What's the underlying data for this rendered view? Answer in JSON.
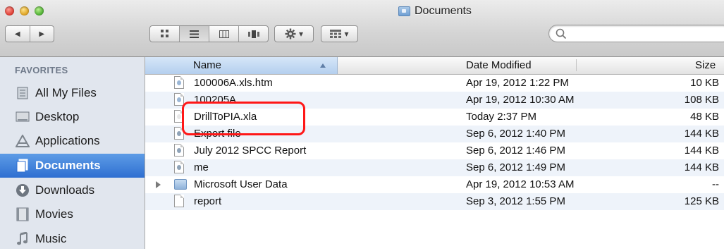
{
  "window": {
    "title": "Documents"
  },
  "toolbar": {
    "back_label": "◀",
    "forward_label": "▶",
    "view_icon": "▾",
    "search_placeholder": ""
  },
  "sidebar": {
    "heading": "FAVORITES",
    "items": [
      {
        "label": "All My Files",
        "icon": "all-files-icon"
      },
      {
        "label": "Desktop",
        "icon": "desktop-icon"
      },
      {
        "label": "Applications",
        "icon": "applications-icon"
      },
      {
        "label": "Documents",
        "icon": "documents-icon",
        "selected": true
      },
      {
        "label": "Downloads",
        "icon": "downloads-icon"
      },
      {
        "label": "Movies",
        "icon": "movies-icon"
      },
      {
        "label": "Music",
        "icon": "music-icon"
      }
    ]
  },
  "list": {
    "columns": {
      "name": "Name",
      "date": "Date Modified",
      "size": "Size"
    },
    "rows": [
      {
        "name": "100006A.xls.htm",
        "date": "Apr 19, 2012 1:22 PM",
        "size": "10 KB"
      },
      {
        "name": "100205A",
        "date": "Apr 19, 2012 10:30 AM",
        "size": "108 KB"
      },
      {
        "name": "DrillToPIA.xla",
        "date": "Today 2:37 PM",
        "size": "48 KB"
      },
      {
        "name": "Export file",
        "date": "Sep 6, 2012 1:40 PM",
        "size": "144 KB"
      },
      {
        "name": "July 2012 SPCC Report",
        "date": "Sep 6, 2012 1:46 PM",
        "size": "144 KB"
      },
      {
        "name": "me",
        "date": "Sep 6, 2012 1:49 PM",
        "size": "144 KB"
      },
      {
        "name": "Microsoft User Data",
        "date": "Apr 19, 2012 10:53 AM",
        "size": "--"
      },
      {
        "name": "report",
        "date": "Sep 3, 2012 1:55 PM",
        "size": "125 KB"
      }
    ]
  },
  "colors": {
    "selection": "#2f6fd1",
    "highlight": "#ff1717",
    "stripe": "#eef3fa"
  }
}
